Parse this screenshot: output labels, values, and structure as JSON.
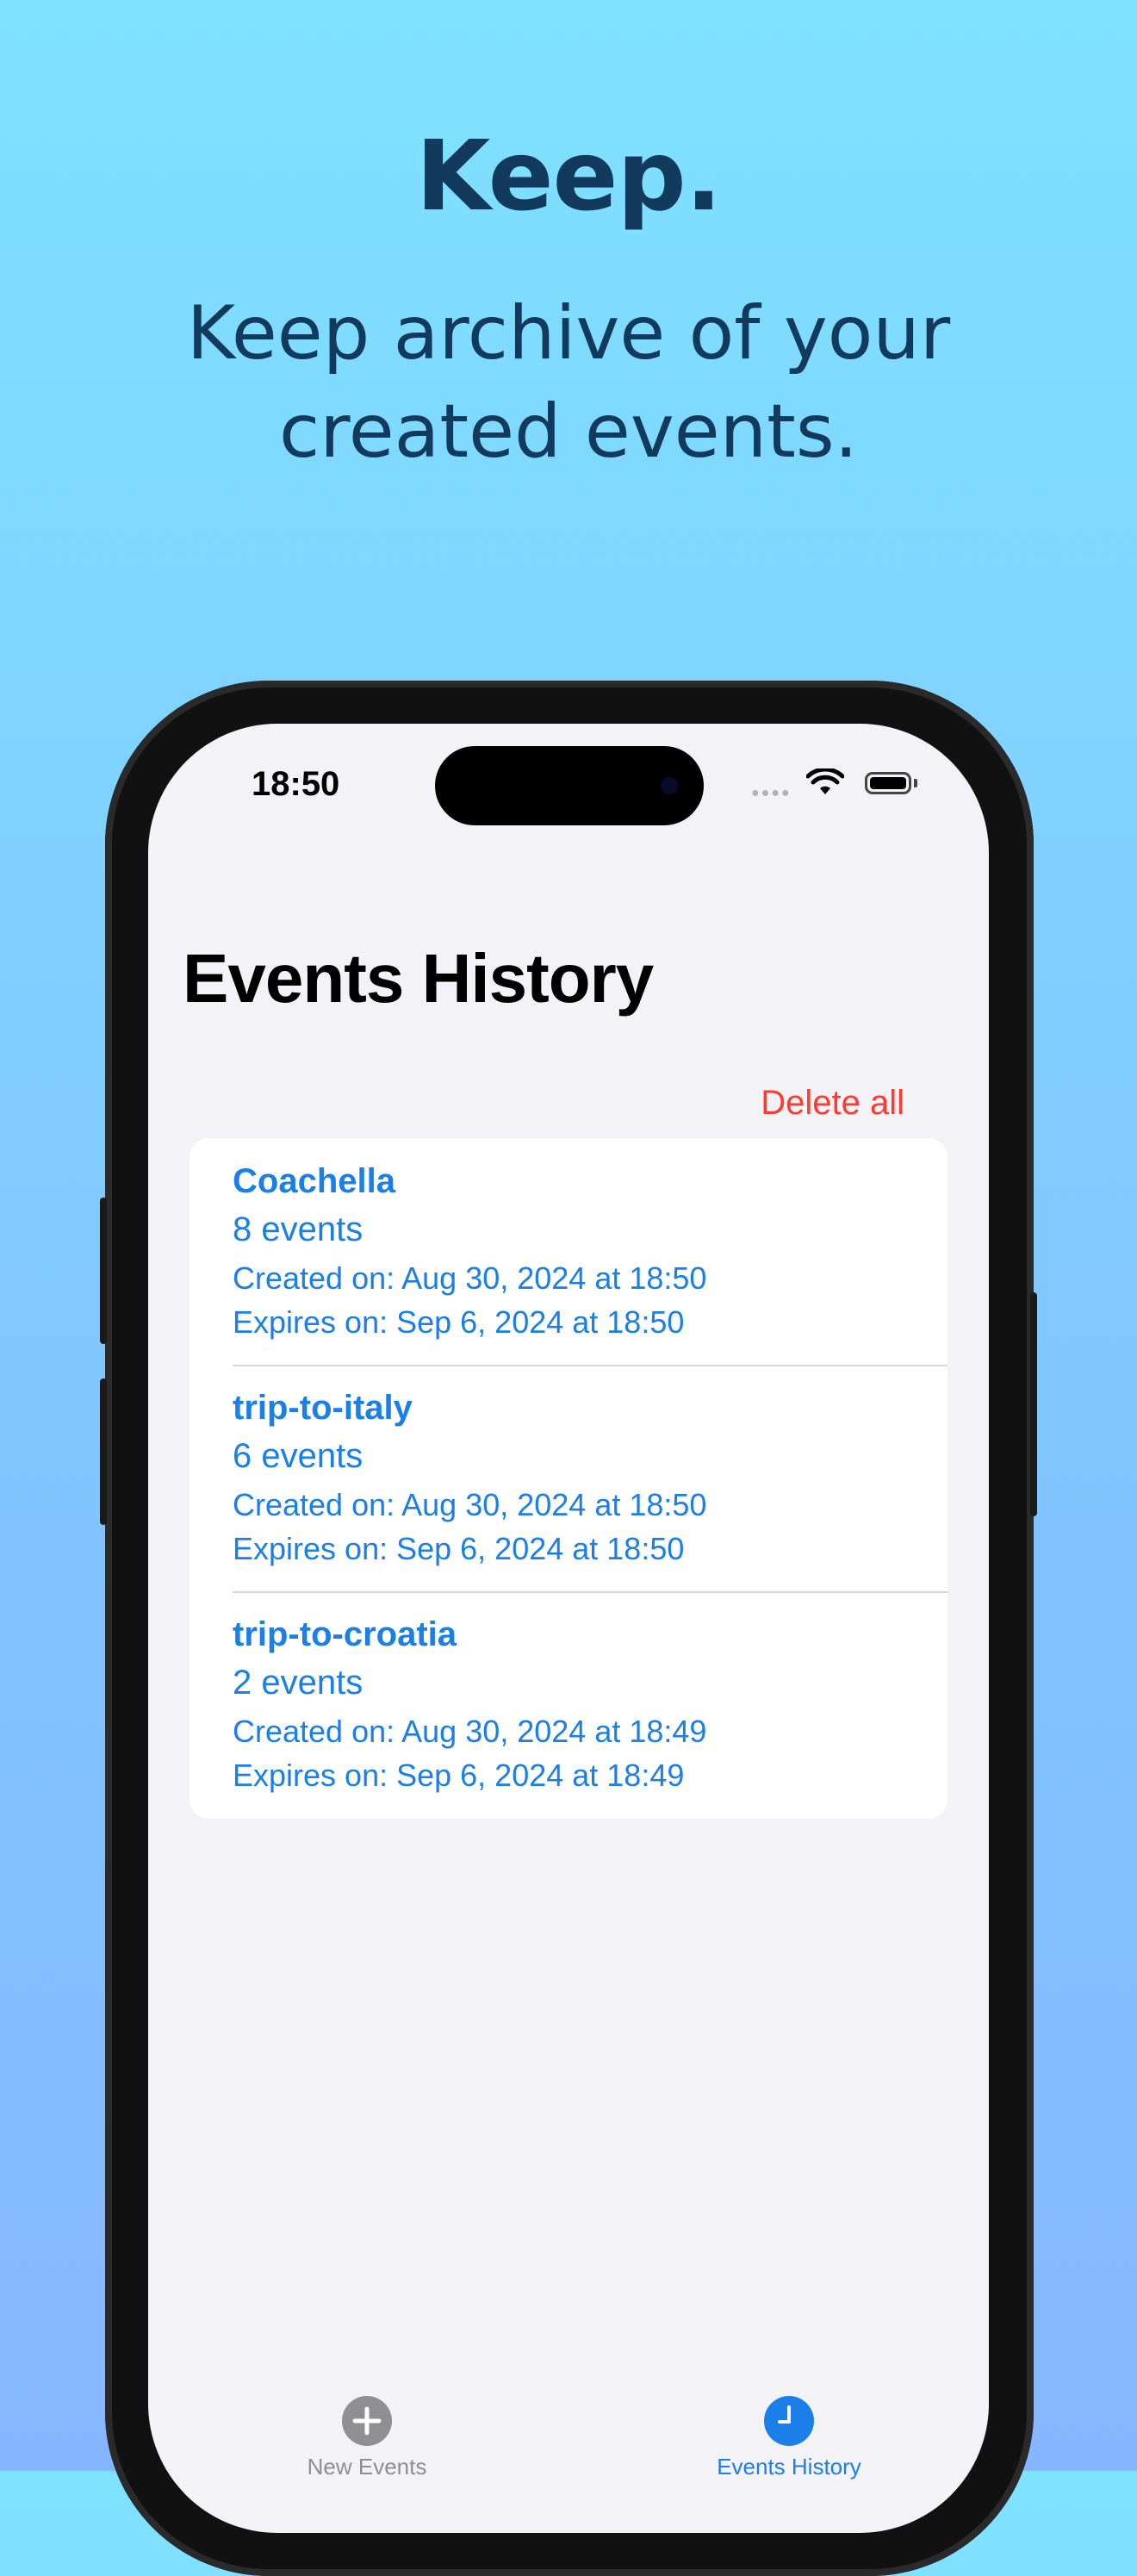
{
  "hero": {
    "title": "Keep.",
    "subtitle_line1": "Keep archive of your",
    "subtitle_line2": "created events."
  },
  "status_bar": {
    "time": "18:50"
  },
  "page": {
    "title": "Events History",
    "delete_all_label": "Delete all"
  },
  "events": [
    {
      "name": "Coachella",
      "count": "8 events",
      "created": "Created on: Aug 30, 2024 at 18:50",
      "expires": "Expires on: Sep 6, 2024 at 18:50"
    },
    {
      "name": "trip-to-italy",
      "count": "6 events",
      "created": "Created on: Aug 30, 2024 at 18:50",
      "expires": "Expires on: Sep 6, 2024 at 18:50"
    },
    {
      "name": "trip-to-croatia",
      "count": "2 events",
      "created": "Created on: Aug 30, 2024 at 18:49",
      "expires": "Expires on: Sep 6, 2024 at 18:49"
    }
  ],
  "tab_bar": {
    "tabs": [
      {
        "label": "New Events",
        "icon": "plus-circle-icon",
        "active": false
      },
      {
        "label": "Events History",
        "icon": "clock-icon",
        "active": true
      }
    ]
  },
  "colors": {
    "accent": "#1a7fe8",
    "destructive": "#ff3b30",
    "hero_text": "#123a5c",
    "inactive_tab": "#8e8e93"
  }
}
